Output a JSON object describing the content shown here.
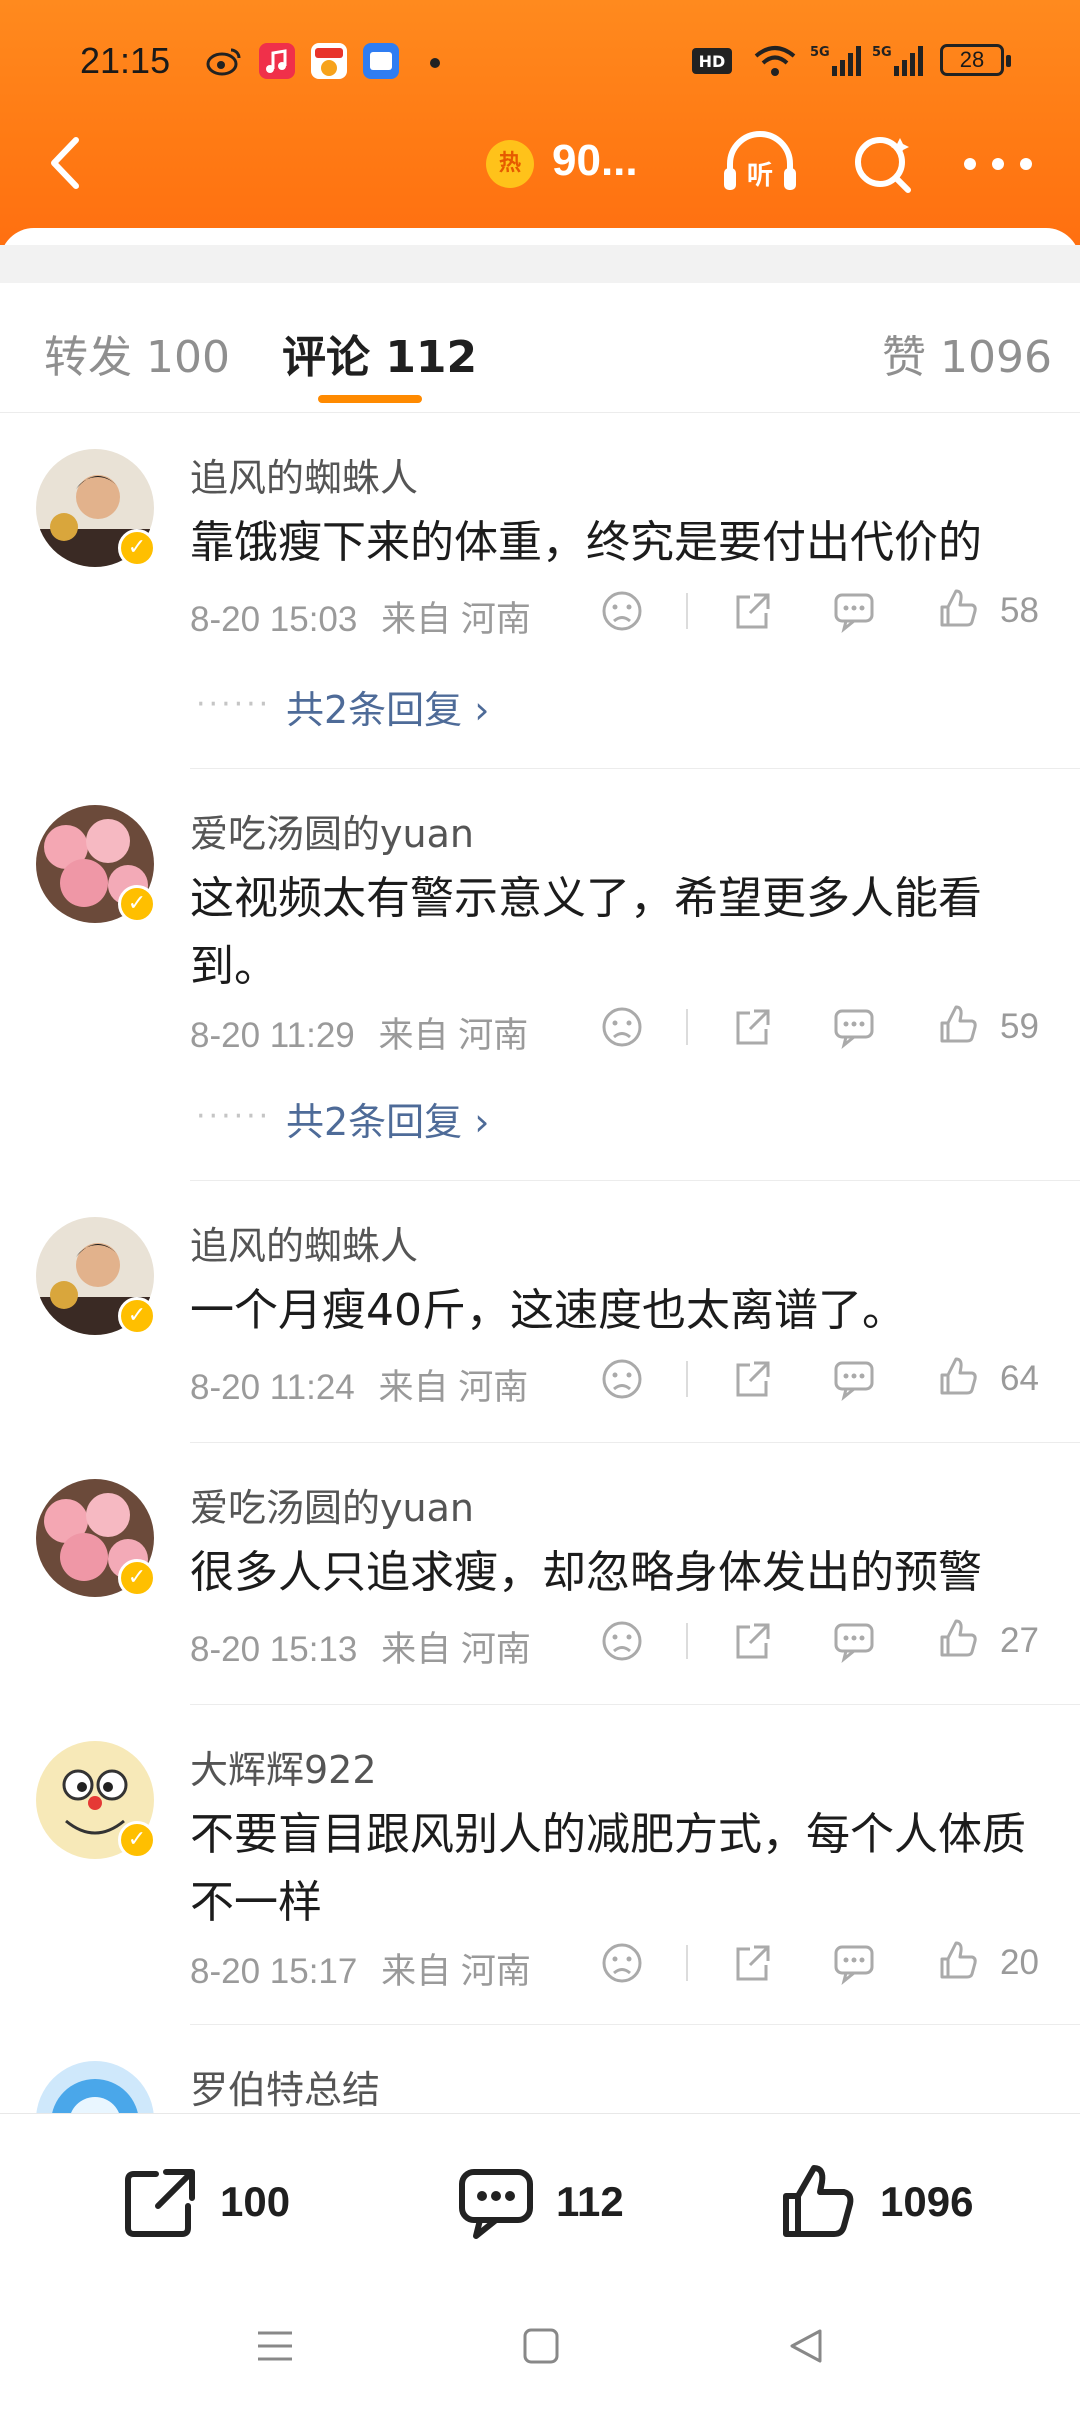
{
  "status_bar": {
    "time": "21:15",
    "battery": "28"
  },
  "nav": {
    "hot_badge": "热",
    "hot_text": "90..."
  },
  "tabs": [
    {
      "label": "转发 100"
    },
    {
      "label": "评论 112"
    },
    {
      "label": "赞 1096"
    }
  ],
  "comments": [
    {
      "user": "追风的蜘蛛人",
      "text": "靠饿瘦下来的体重，终究是要付出代价的",
      "time": "8-20 15:03",
      "source": "来自 河南",
      "likes": "58",
      "replies": "共2条回复 ›",
      "avatar": "man"
    },
    {
      "user": "爱吃汤圆的yuan",
      "text": "这视频太有警示意义了，希望更多人能看到。",
      "time": "8-20 11:29",
      "source": "来自 河南",
      "likes": "59",
      "replies": "共2条回复 ›",
      "avatar": "roses"
    },
    {
      "user": "追风的蜘蛛人",
      "text": "一个月瘦40斤，这速度也太离谱了。",
      "time": "8-20 11:24",
      "source": "来自 河南",
      "likes": "64",
      "replies": "",
      "avatar": "man"
    },
    {
      "user": "爱吃汤圆的yuan",
      "text": "很多人只追求瘦，却忽略身体发出的预警",
      "time": "8-20 15:13",
      "source": "来自 河南",
      "likes": "27",
      "replies": "",
      "avatar": "roses"
    },
    {
      "user": "大辉辉922",
      "text": "不要盲目跟风别人的减肥方式，每个人体质不一样",
      "time": "8-20 15:17",
      "source": "来自 河南",
      "likes": "20",
      "replies": "",
      "avatar": "cartoon"
    },
    {
      "user": "罗伯特总结",
      "text": "",
      "time": "",
      "source": "",
      "likes": "",
      "replies": "",
      "avatar": "blue"
    }
  ],
  "bottom_bar": {
    "repost_count": "100",
    "comment_count": "112",
    "like_count": "1096"
  },
  "colors": {
    "header": "#ff7a14",
    "accent": "#ff8a00",
    "link": "#4e6b98",
    "verified": "#ffbf00"
  },
  "icons": [
    "back-icon",
    "listen-icon",
    "search-icon",
    "more-icon",
    "dislike-icon",
    "share-icon",
    "comment-icon",
    "like-icon"
  ]
}
